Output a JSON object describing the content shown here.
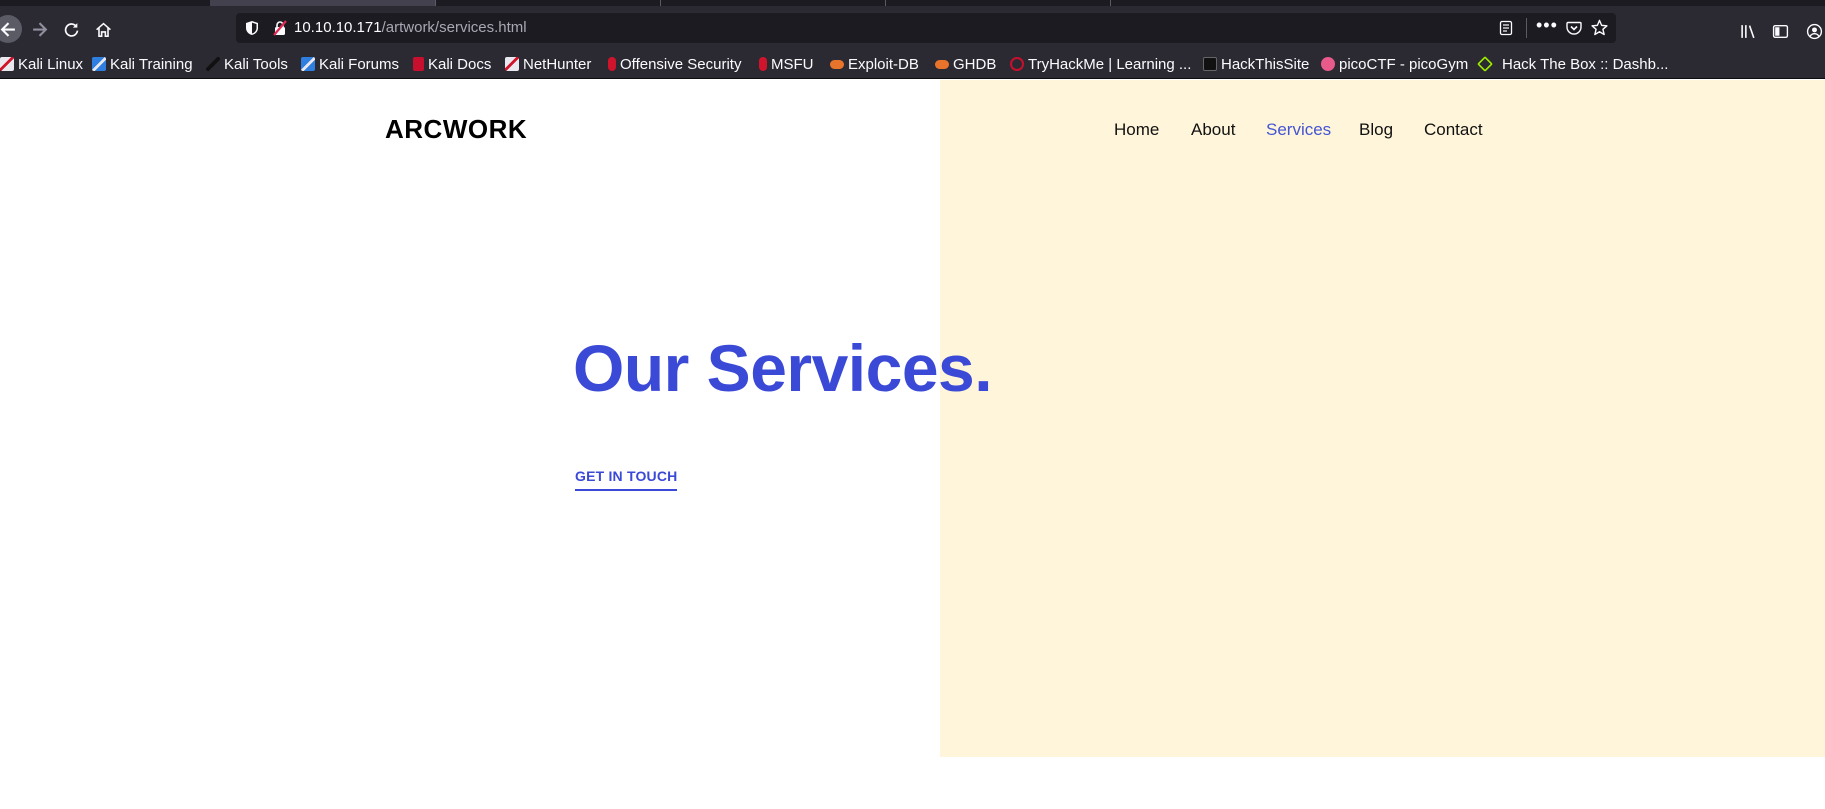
{
  "browser": {
    "url_host": "10.10.10.171",
    "url_path": "/artwork/services.html",
    "toolbar_icons": [
      "back-arrow-icon",
      "forward-arrow-icon",
      "reload-icon",
      "home-icon",
      "shield-icon",
      "insecure-lock-icon",
      "reader-view-icon",
      "more-icon",
      "pocket-icon",
      "bookmark-star-icon",
      "library-icon",
      "sidebar-icon",
      "account-icon"
    ],
    "more_label": "•••"
  },
  "bookmarks": [
    {
      "label": "Kali Linux",
      "icon": "kali-dragon-icon",
      "color": "#e8e8ee"
    },
    {
      "label": "Kali Training",
      "icon": "kali-training-icon",
      "color": "#2f7fe0"
    },
    {
      "label": "Kali Tools",
      "icon": "kali-tools-icon",
      "color": "#1a1a1a"
    },
    {
      "label": "Kali Forums",
      "icon": "kali-forums-icon",
      "color": "#2f7fe0"
    },
    {
      "label": "Kali Docs",
      "icon": "kali-docs-icon",
      "color": "#c8102e"
    },
    {
      "label": "NetHunter",
      "icon": "nethunter-icon",
      "color": "#e8e8ee"
    },
    {
      "label": "Offensive Security",
      "icon": "offsec-icon",
      "color": "#d0142c"
    },
    {
      "label": "MSFU",
      "icon": "msfu-icon",
      "color": "#d0142c"
    },
    {
      "label": "Exploit-DB",
      "icon": "exploit-db-icon",
      "color": "#e8742c"
    },
    {
      "label": "GHDB",
      "icon": "ghdb-icon",
      "color": "#e8742c"
    },
    {
      "label": "TryHackMe | Learning ...",
      "icon": "tryhackme-icon",
      "color": "#c8102e"
    },
    {
      "label": "HackThisSite",
      "icon": "hackthissite-icon",
      "color": "#111111"
    },
    {
      "label": "picoCTF - picoGym",
      "icon": "picoctf-icon",
      "color": "#e85a8a"
    },
    {
      "label": "Hack The Box :: Dashb...",
      "icon": "hackthebox-icon",
      "color": "#9fef00"
    }
  ],
  "site": {
    "brand": "ARCWORK",
    "nav": [
      {
        "label": "Home",
        "active": false
      },
      {
        "label": "About",
        "active": false
      },
      {
        "label": "Services",
        "active": true
      },
      {
        "label": "Blog",
        "active": false
      },
      {
        "label": "Contact",
        "active": false
      }
    ],
    "hero_title": "Our Services.",
    "cta": "GET IN TOUCH",
    "accent_color": "#3a49d6",
    "panel_color": "#fef5da"
  }
}
